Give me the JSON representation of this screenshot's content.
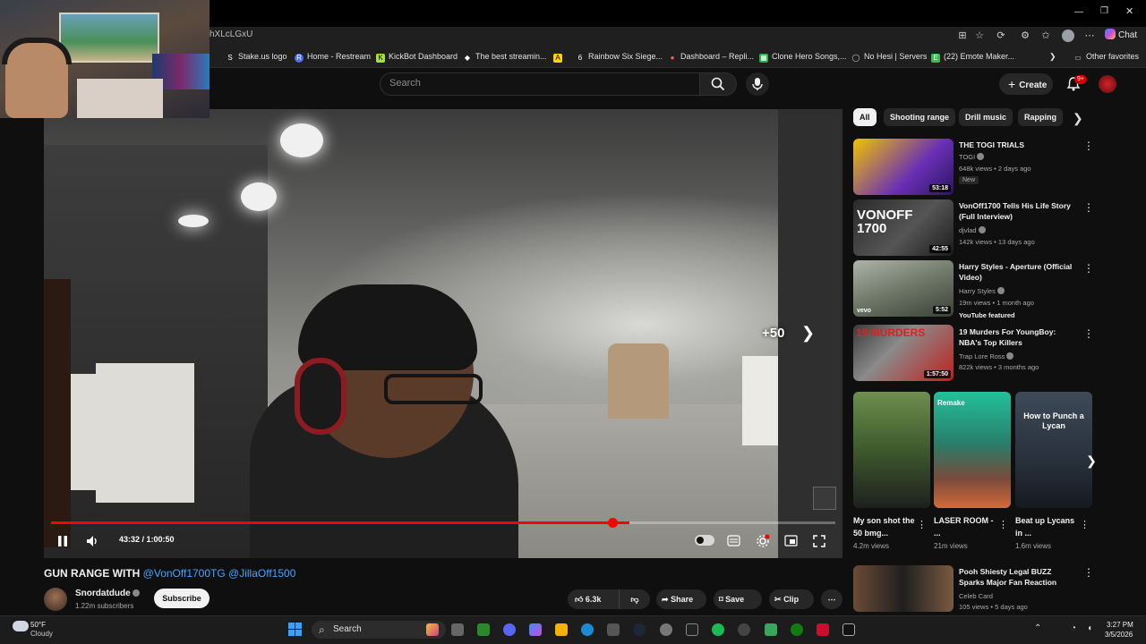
{
  "browser": {
    "url_fragment": "hXLcLGxU",
    "copilot_label": "Chat",
    "bookmarks": [
      {
        "label": "Stake.us logo",
        "icon": "S",
        "color": "#ffffff"
      },
      {
        "label": "Home - Restream",
        "icon": "R",
        "color": "#4b6cf5"
      },
      {
        "label": "KickBot Dashboard",
        "icon": "K",
        "color": "#a6e22e"
      },
      {
        "label": "The best streamin...",
        "icon": "◆",
        "color": "#ffffff"
      },
      {
        "label": "",
        "icon": "A",
        "color": "#ffd400"
      },
      {
        "label": "Rainbow Six Siege...",
        "icon": "6",
        "color": "#ffffff"
      },
      {
        "label": "Dashboard – Repli...",
        "icon": "●",
        "color": "#ff5a5a"
      },
      {
        "label": "Clone Hero Songs,...",
        "icon": "▦",
        "color": "#22b14c"
      },
      {
        "label": "No Hesi | Servers",
        "icon": "◯",
        "color": "#cfcfcf"
      },
      {
        "label": "(22) Emote Maker...",
        "icon": "E",
        "color": "#3cba54"
      },
      {
        "label": "Other favorites",
        "icon": "▭",
        "color": "#cfcfcf"
      }
    ]
  },
  "youtube": {
    "search_placeholder": "Search",
    "create_label": "Create",
    "notification_count": "9+"
  },
  "player": {
    "skip_label": "+50",
    "time": "43:32 / 1:00:50",
    "progress": {
      "played": 0.7375,
      "buffered": 0.7375
    }
  },
  "video": {
    "title_prefix": "GUN RANGE WITH",
    "mention_1": "@VonOff1700TG",
    "mention_2": "@JillaOff1500",
    "channel_name": "Snordatdude",
    "subscribers": "1.22m subscribers",
    "subscribe_label": "Subscribe",
    "likes": "6.3k",
    "share_label": "Share",
    "save_label": "Save",
    "clip_label": "Clip"
  },
  "chips": [
    "All",
    "Shooting range",
    "Drill music",
    "Rapping"
  ],
  "recommendations": [
    {
      "title": "THE TOGI TRIALS",
      "channel": "TOGI",
      "meta": "648k views • 2 days ago",
      "badge": "New",
      "featured": "",
      "duration": "53:18"
    },
    {
      "title": "VonOff1700 Tells His Life Story (Full Interview)",
      "channel": "djvlad",
      "meta": "142k views • 13 days ago",
      "badge": "",
      "featured": "",
      "duration": "42:55"
    },
    {
      "title": "Harry Styles - Aperture (Official Video)",
      "channel": "Harry Styles",
      "meta": "19m views • 1 month ago",
      "badge": "",
      "featured": "YouTube featured",
      "duration": "5:52"
    },
    {
      "title": "19 Murders For YoungBoy: NBA's Top Killers",
      "channel": "Trap Lore Ross",
      "meta": "822k views • 3 months ago",
      "badge": "",
      "featured": "",
      "duration": "1:57:50"
    },
    {
      "title": "Pooh Shiesty Legal BUZZ Sparks Major Fan Reaction",
      "channel": "Celeb Card",
      "meta": "105 views • 5 days ago",
      "badge": "",
      "featured": "",
      "duration": ""
    }
  ],
  "rec_thumb_text": {
    "vonoff": "VONOFF 1700",
    "murders": "19 MURDERS"
  },
  "shorts": [
    {
      "title": "My son shot the 50 bmg...",
      "views": "4.2m views",
      "overlay": ""
    },
    {
      "title": "LASER ROOM - ...",
      "views": "21m views",
      "overlay": "Remake"
    },
    {
      "title": "Beat up Lycans in ...",
      "views": "1.6m views",
      "overlay": "How to Punch a Lycan"
    }
  ],
  "taskbar": {
    "temp": "50°F",
    "weather": "Cloudy",
    "search_label": "Search",
    "time": "3:27 PM",
    "date": "3/5/2026"
  },
  "colors": {
    "accent": "#ff0000",
    "link": "#3ea6ff",
    "bg": "#0f0f0f"
  }
}
